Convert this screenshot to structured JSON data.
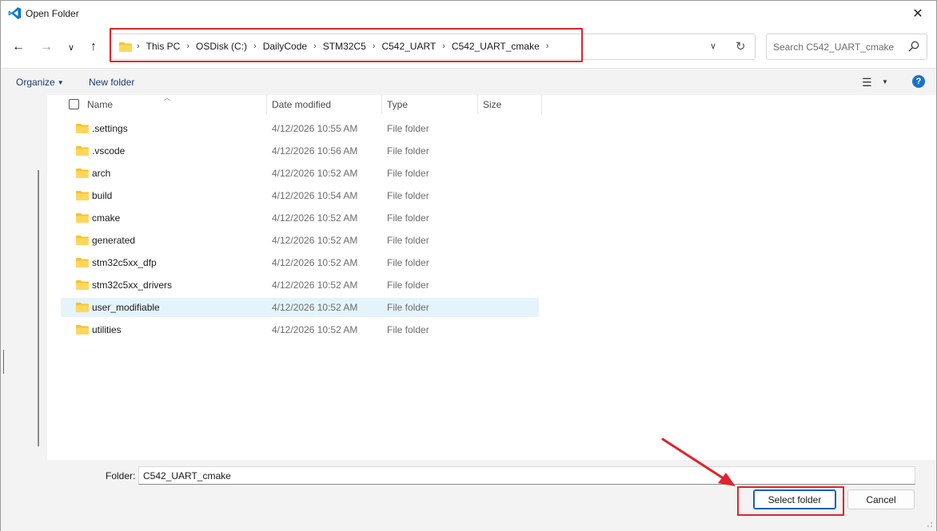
{
  "window": {
    "title": "Open Folder"
  },
  "nav": {
    "back": "back-arrow",
    "forward": "forward-arrow",
    "recent": "chevron-down",
    "up": "up-arrow",
    "breadcrumbs": [
      "This PC",
      "OSDisk (C:)",
      "DailyCode",
      "STM32C5",
      "C542_UART",
      "C542_UART_cmake"
    ],
    "search_placeholder": "Search C542_UART_cmake"
  },
  "toolbar": {
    "organize": "Organize",
    "new_folder": "New folder"
  },
  "columns": {
    "name": "Name",
    "date": "Date modified",
    "type": "Type",
    "size": "Size"
  },
  "files": [
    {
      "name": ".settings",
      "date": "4/12/2026 10:55 AM",
      "type": "File folder"
    },
    {
      "name": ".vscode",
      "date": "4/12/2026 10:56 AM",
      "type": "File folder"
    },
    {
      "name": "arch",
      "date": "4/12/2026 10:52 AM",
      "type": "File folder"
    },
    {
      "name": "build",
      "date": "4/12/2026 10:54 AM",
      "type": "File folder"
    },
    {
      "name": "cmake",
      "date": "4/12/2026 10:52 AM",
      "type": "File folder"
    },
    {
      "name": "generated",
      "date": "4/12/2026 10:52 AM",
      "type": "File folder"
    },
    {
      "name": "stm32c5xx_dfp",
      "date": "4/12/2026 10:52 AM",
      "type": "File folder"
    },
    {
      "name": "stm32c5xx_drivers",
      "date": "4/12/2026 10:52 AM",
      "type": "File folder"
    },
    {
      "name": "user_modifiable",
      "date": "4/12/2026 10:52 AM",
      "type": "File folder",
      "selected": true
    },
    {
      "name": "utilities",
      "date": "4/12/2026 10:52 AM",
      "type": "File folder"
    }
  ],
  "footer": {
    "folder_label": "Folder:",
    "folder_value": "C542_UART_cmake",
    "select_button": "Select folder",
    "cancel_button": "Cancel"
  },
  "colors": {
    "accent": "#1b5fb5",
    "annotation": "#e0242d",
    "folder": "#f4c430",
    "selected_row": "#e5f3fb"
  }
}
